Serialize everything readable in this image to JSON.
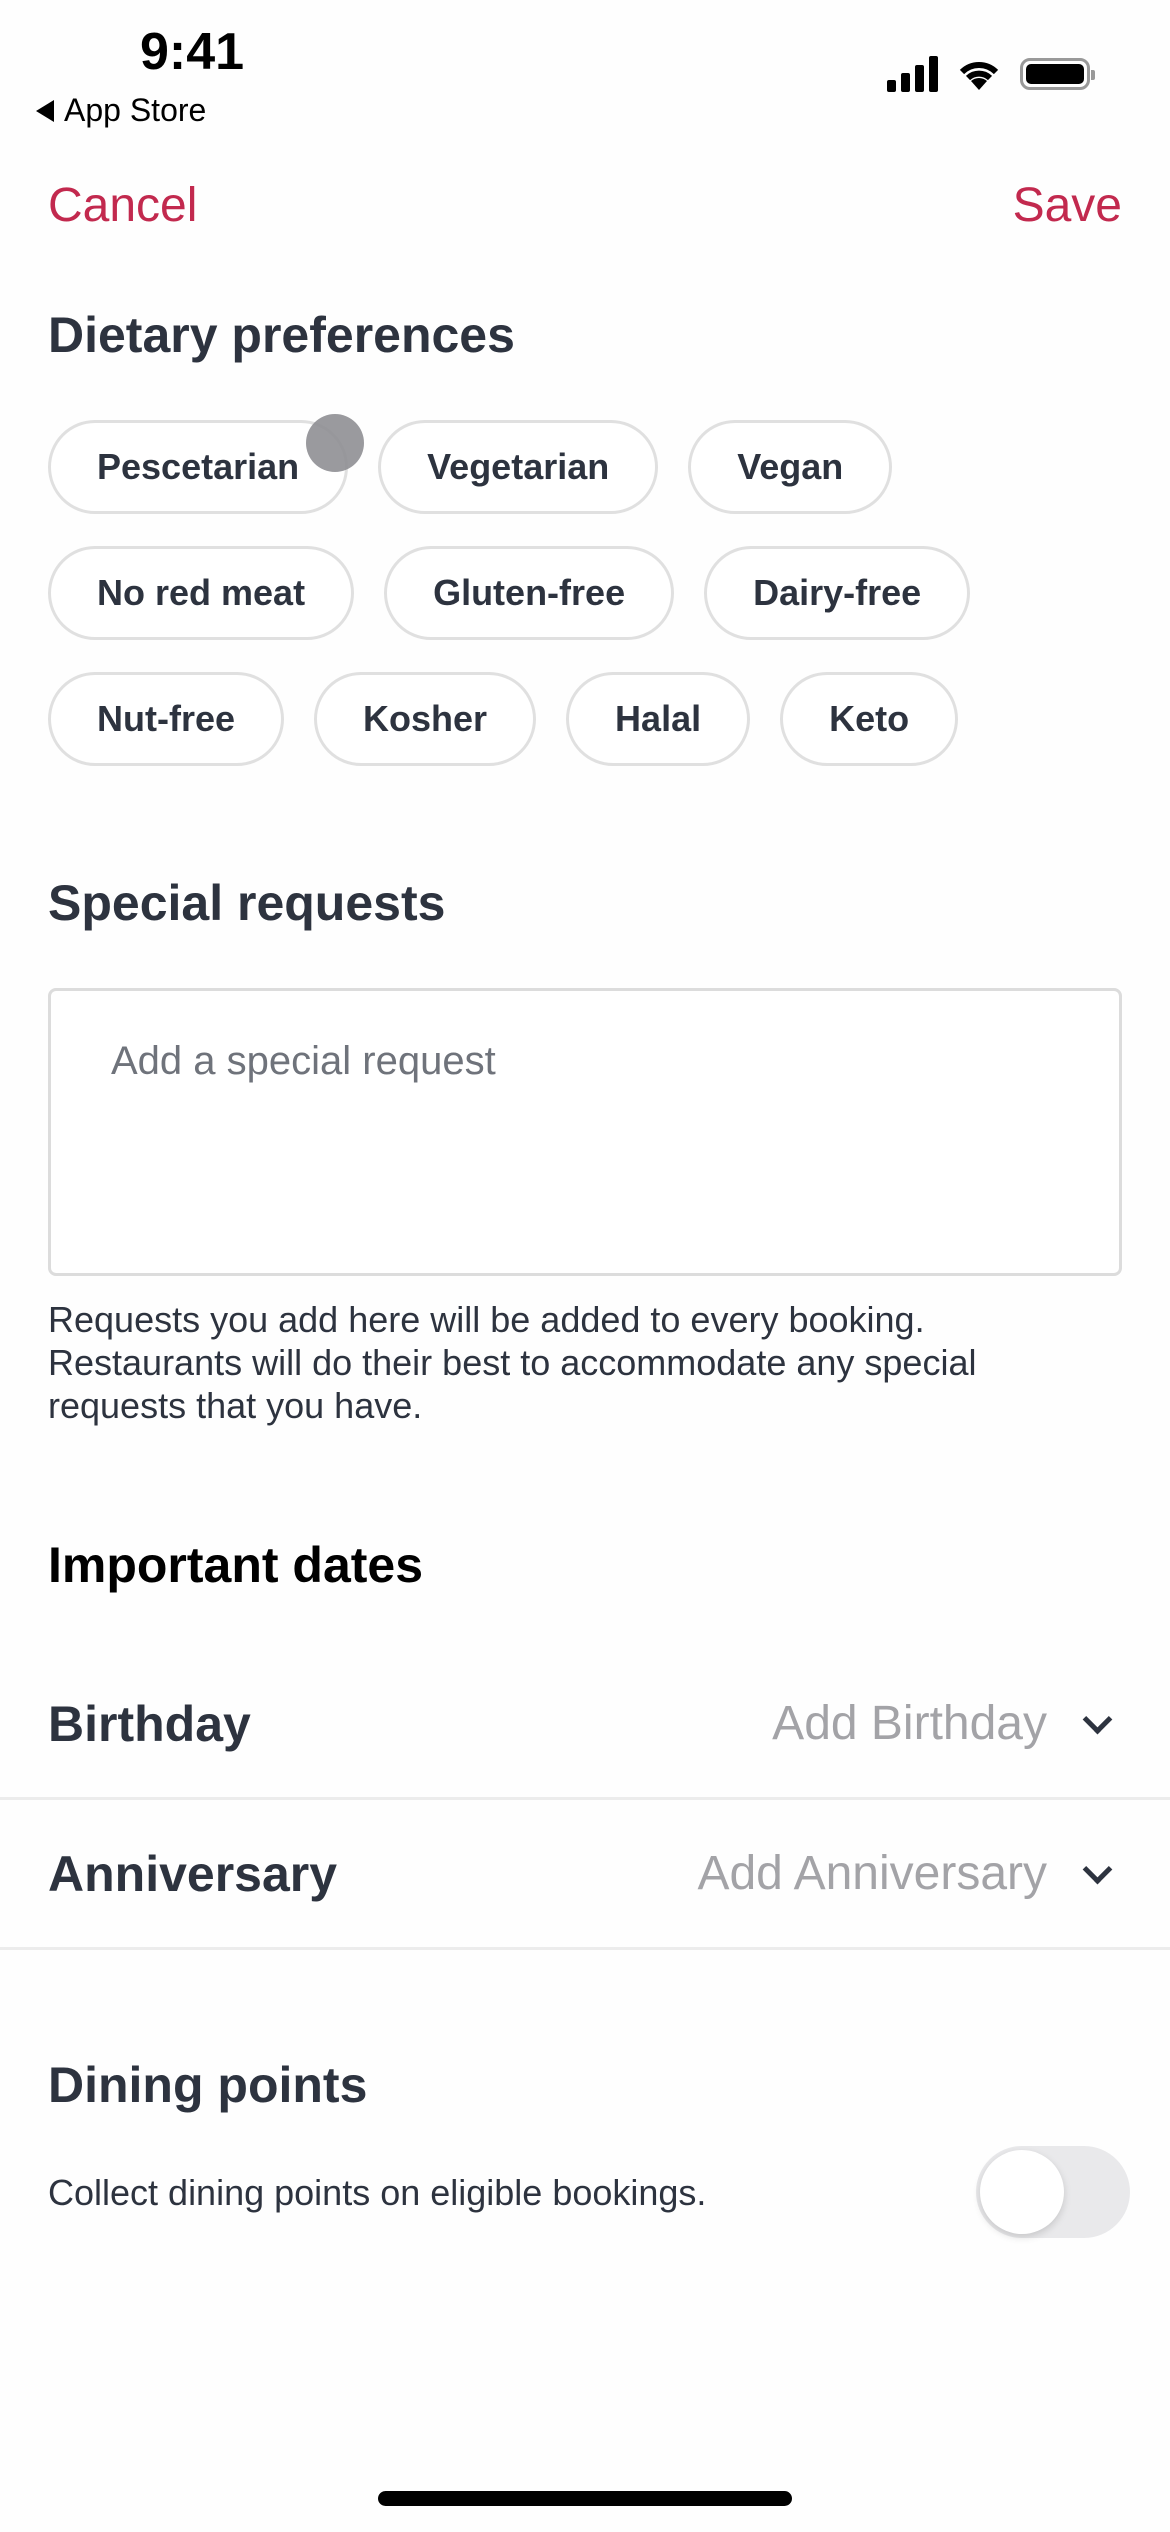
{
  "status_bar": {
    "time": "9:41",
    "back_app": "App Store"
  },
  "nav": {
    "cancel_label": "Cancel",
    "save_label": "Save",
    "accent_color": "#c2294e"
  },
  "dietary": {
    "title": "Dietary preferences",
    "rows": [
      [
        "Pescetarian",
        "Vegetarian",
        "Vegan"
      ],
      [
        "No red meat",
        "Gluten-free",
        "Dairy-free"
      ],
      [
        "Nut-free",
        "Kosher",
        "Halal",
        "Keto"
      ]
    ]
  },
  "special_requests": {
    "title": "Special requests",
    "placeholder": "Add a special request",
    "value": "",
    "helper": "Requests you add here will be added to every booking. Restaurants will do their best to accommodate any special requests that you have."
  },
  "important_dates": {
    "title": "Important dates",
    "items": [
      {
        "label": "Birthday",
        "value": "Add Birthday"
      },
      {
        "label": "Anniversary",
        "value": "Add Anniversary"
      }
    ]
  },
  "dining_points": {
    "title": "Dining points",
    "description": "Collect dining points on eligible bookings.",
    "enabled": false
  }
}
